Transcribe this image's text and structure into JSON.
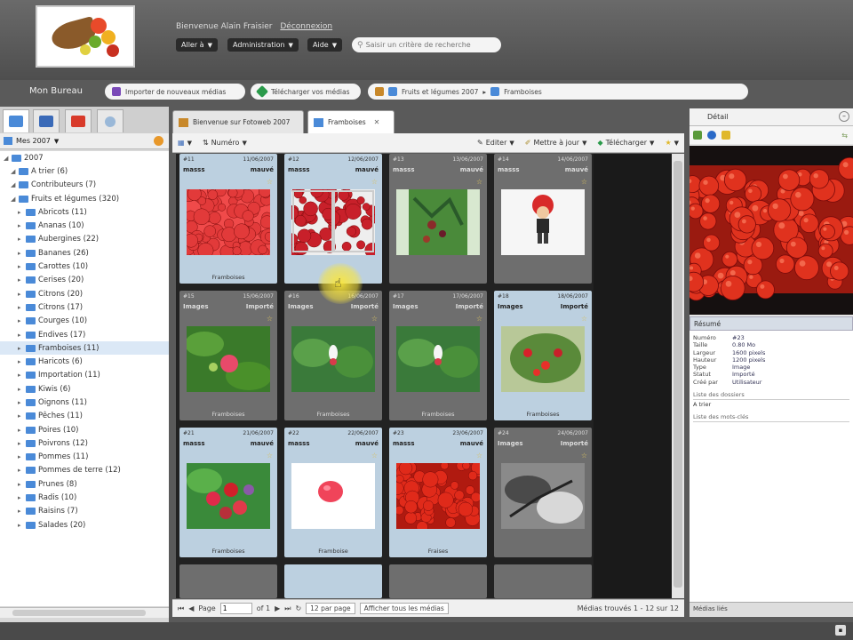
{
  "header": {
    "welcome": "Bienvenue Alain Fraisier",
    "logout": "Déconnexion",
    "menu_aller": "Aller à",
    "menu_admin": "Administration",
    "menu_aide": "Aide",
    "search_placeholder": "Saisir un critère de recherche"
  },
  "bureau": {
    "title": "Mon Bureau",
    "btn_import": "Importer de nouveaux médias",
    "btn_share": "Télécharger vos médias",
    "breadcrumb_1": "Fruits et légumes 2007",
    "breadcrumb_2": "Framboises"
  },
  "left": {
    "selector": "Mes 2007",
    "tree": [
      {
        "label": "2007",
        "indent": 0
      },
      {
        "label": "A trier (6)",
        "indent": 1
      },
      {
        "label": "Contributeurs (7)",
        "indent": 1
      },
      {
        "label": "Fruits et légumes (320)",
        "indent": 1
      },
      {
        "label": "Abricots (11)",
        "indent": 2
      },
      {
        "label": "Ananas (10)",
        "indent": 2
      },
      {
        "label": "Aubergines (22)",
        "indent": 2
      },
      {
        "label": "Bananes (26)",
        "indent": 2
      },
      {
        "label": "Carottes (10)",
        "indent": 2
      },
      {
        "label": "Cerises (20)",
        "indent": 2
      },
      {
        "label": "Citrons (20)",
        "indent": 2
      },
      {
        "label": "Citrons (17)",
        "indent": 2
      },
      {
        "label": "Courges (10)",
        "indent": 2
      },
      {
        "label": "Endives (17)",
        "indent": 2
      },
      {
        "label": "Framboises (11)",
        "indent": 2,
        "selected": true
      },
      {
        "label": "Haricots (6)",
        "indent": 2
      },
      {
        "label": "Importation (11)",
        "indent": 2
      },
      {
        "label": "Kiwis (6)",
        "indent": 2
      },
      {
        "label": "Oignons (11)",
        "indent": 2
      },
      {
        "label": "Pêches (11)",
        "indent": 2
      },
      {
        "label": "Poires (10)",
        "indent": 2
      },
      {
        "label": "Poivrons (12)",
        "indent": 2
      },
      {
        "label": "Pommes (11)",
        "indent": 2
      },
      {
        "label": "Pommes de terre (12)",
        "indent": 2
      },
      {
        "label": "Prunes (8)",
        "indent": 2
      },
      {
        "label": "Radis (10)",
        "indent": 2
      },
      {
        "label": "Raisins (7)",
        "indent": 2
      },
      {
        "label": "Salades (20)",
        "indent": 2
      }
    ]
  },
  "tabs": {
    "tab1": "Bienvenue sur Fotoweb 2007",
    "tab2": "Framboises"
  },
  "toolbar": {
    "sort": "Numéro",
    "edit": "Editer",
    "basket": "Mettre à jour",
    "download": "Télécharger"
  },
  "cards": [
    {
      "num": "#11",
      "date": "11/06/2007",
      "who": "masss",
      "status": "mauvé",
      "cap": "Framboises",
      "tone": "light",
      "img": "rasp_red"
    },
    {
      "num": "#12",
      "date": "12/06/2007",
      "who": "masss",
      "status": "mauvé",
      "cap": "",
      "tone": "light",
      "img": "rasp_box"
    },
    {
      "num": "#13",
      "date": "13/06/2007",
      "who": "masss",
      "status": "mauvé",
      "cap": "",
      "tone": "dark",
      "img": "bush"
    },
    {
      "num": "#14",
      "date": "14/06/2007",
      "who": "masss",
      "status": "mauvé",
      "cap": "",
      "tone": "dark",
      "img": "figure"
    },
    {
      "num": "#15",
      "date": "15/06/2007",
      "who": "Images",
      "status": "Importé",
      "cap": "Framboises",
      "tone": "dark",
      "img": "leaf_rasp"
    },
    {
      "num": "#16",
      "date": "16/06/2007",
      "who": "Images",
      "status": "Importé",
      "cap": "Framboises",
      "tone": "dark",
      "img": "leaf_white"
    },
    {
      "num": "#17",
      "date": "17/06/2007",
      "who": "Images",
      "status": "Importé",
      "cap": "Framboises",
      "tone": "dark",
      "img": "leaf_white2"
    },
    {
      "num": "#18",
      "date": "18/06/2007",
      "who": "Images",
      "status": "Importé",
      "cap": "Framboises",
      "tone": "light",
      "img": "plant_red"
    },
    {
      "num": "#21",
      "date": "21/06/2007",
      "who": "masss",
      "status": "mauvé",
      "cap": "Framboises",
      "tone": "light",
      "img": "rasp_cluster"
    },
    {
      "num": "#22",
      "date": "22/06/2007",
      "who": "masss",
      "status": "mauvé",
      "cap": "Framboise",
      "tone": "light",
      "img": "single"
    },
    {
      "num": "#23",
      "date": "23/06/2007",
      "who": "masss",
      "status": "mauvé",
      "cap": "Fraises",
      "tone": "light",
      "img": "strawberries"
    },
    {
      "num": "#24",
      "date": "24/06/2007",
      "who": "Images",
      "status": "Importé",
      "cap": "",
      "tone": "dark",
      "img": "bw"
    }
  ],
  "pager": {
    "page_label": "Page",
    "page_value": "1",
    "of": "of 1",
    "per_page": "12 par page",
    "filter": "Afficher tous les médias",
    "result": "Médias trouvés 1 - 12 sur 12"
  },
  "right": {
    "title": "Détail",
    "props_title": "Résumé",
    "props": [
      {
        "k": "Numéro",
        "v": "#23"
      },
      {
        "k": "Taille",
        "v": "0.80 Mo"
      },
      {
        "k": "Largeur",
        "v": "1600 pixels"
      },
      {
        "k": "Hauteur",
        "v": "1200 pixels"
      },
      {
        "k": "Type",
        "v": "Image"
      },
      {
        "k": "Statut",
        "v": "Importé"
      },
      {
        "k": "Créé par",
        "v": "Utilisateur"
      }
    ],
    "sec1": "Liste des dossiers",
    "sec1_val": "A trier",
    "sec2": "Liste des mots-clés",
    "foot": "Médias liés"
  },
  "colors": {
    "light_card": "#bcd0e0",
    "dark_card": "#6e6e6e",
    "accent_blue": "#4a8ad8"
  }
}
